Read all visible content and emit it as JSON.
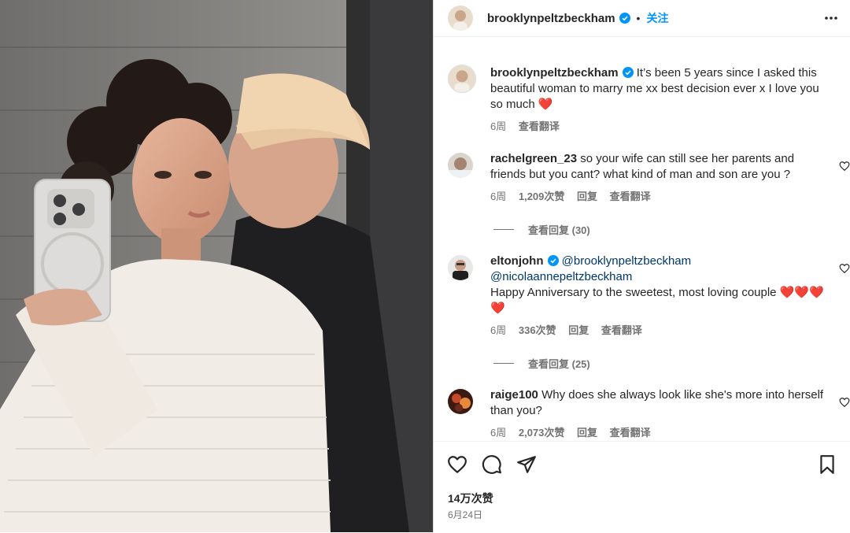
{
  "post": {
    "author": "brooklynpeltzbeckham",
    "follow_label": "关注",
    "dot": "•",
    "caption_author": "brooklynpeltzbeckham",
    "caption_text": "It’s been 5 years since I asked this beautiful woman to marry me xx best decision ever x I love you so much ❤️",
    "caption_time": "6周",
    "caption_translate": "查看翻译",
    "likes": "14万次赞",
    "date": "6月24日"
  },
  "comments": [
    {
      "user": "rachelgreen_23",
      "text": "so your wife can still see her parents and friends but you cant? what kind of man and son are you ?",
      "time": "6周",
      "likes": "1,209次赞",
      "reply": "回复",
      "translate": "查看翻译",
      "view_replies": "查看回复 (30)"
    },
    {
      "user": "eltonjohn",
      "mention1": "@brooklynpeltzbeckham",
      "mention2": "@nicolaannepeltzbeckham",
      "text": "Happy Anniversary to the sweetest, most loving couple ❤️❤️❤️❤️",
      "time": "6周",
      "likes": "336次赞",
      "reply": "回复",
      "translate": "查看翻译",
      "view_replies": "查看回复 (25)"
    },
    {
      "user": "raige100",
      "text": "Why does she always look like she's more into herself than you?",
      "time": "6周",
      "likes": "2,073次赞",
      "reply": "回复",
      "translate": "查看翻译"
    }
  ],
  "icons": {
    "verified": "verified-badge-icon",
    "more": "more-options-icon",
    "like": "heart-icon",
    "comment": "comment-bubble-icon",
    "share": "paper-plane-icon",
    "save": "bookmark-icon"
  },
  "colors": {
    "accent": "#0095f6",
    "text": "#262626",
    "secondary": "#737373",
    "mention": "#00376b"
  }
}
